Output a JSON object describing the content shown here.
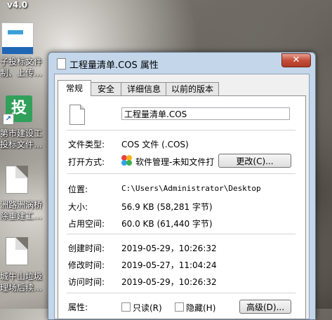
{
  "desktop": {
    "version": "v4.0",
    "icons": [
      {
        "label1": "子投标文件",
        "label2": "制、上传…"
      },
      {
        "label1": "第市建设工",
        "label2": "投标文件…",
        "badge": "投"
      },
      {
        "label1": "洲路洲涡桥",
        "label2": "除重建工…"
      },
      {
        "label1": "城牛山垃圾",
        "label2": "理场后续…"
      }
    ]
  },
  "window": {
    "title": "工程量清单.COS 属性",
    "close": "✕",
    "tabs": [
      "常规",
      "安全",
      "详细信息",
      "以前的版本"
    ],
    "active_tab": "常规",
    "filename": "工程量清单.COS",
    "fields": {
      "type_label": "文件类型:",
      "type_value": "COS 文件 (.COS)",
      "open_label": "打开方式:",
      "open_value": "软件管理-未知文件打",
      "change_button": "更改(C)...",
      "location_label": "位置:",
      "location_value": "C:\\Users\\Administrator\\Desktop",
      "size_label": "大小:",
      "size_value": "56.9 KB (58,281 字节)",
      "disk_label": "占用空间:",
      "disk_value": "60.0 KB (61,440 字节)",
      "created_label": "创建时间:",
      "created_value": "2019-05-29，10:26:32",
      "modified_label": "修改时间:",
      "modified_value": "2019-05-27，11:04:24",
      "accessed_label": "访问时间:",
      "accessed_value": "2019-05-29，10:26:32",
      "attr_label": "属性:",
      "readonly_label": "只读(R)",
      "hidden_label": "隐藏(H)",
      "advanced_button": "高级(D)..."
    }
  }
}
